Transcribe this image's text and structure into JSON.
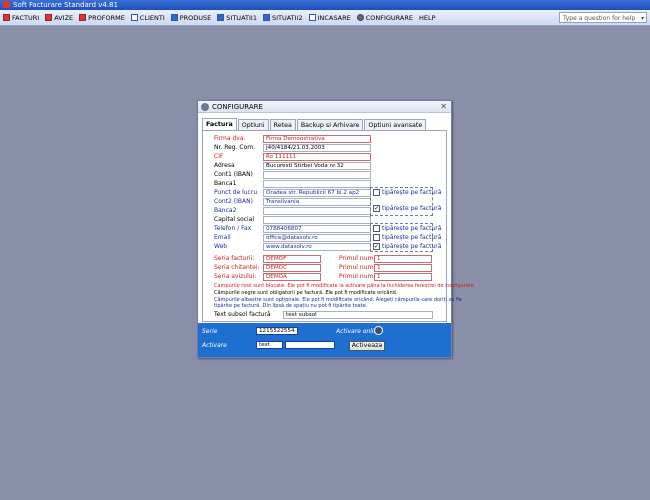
{
  "window": {
    "title": "Soft Facturare Standard v4.81"
  },
  "menu": {
    "items": [
      {
        "label": "FACTURI"
      },
      {
        "label": "AVIZE"
      },
      {
        "label": "PROFORME"
      },
      {
        "label": "CLIENTI"
      },
      {
        "label": "PRODUSE"
      },
      {
        "label": "SITUATII1"
      },
      {
        "label": "SITUATII2"
      },
      {
        "label": "INCASARE"
      },
      {
        "label": "CONFIGURARE"
      },
      {
        "label": "HELP"
      }
    ],
    "help_placeholder": "Type a question for help"
  },
  "dialog": {
    "title": "CONFIGURARE",
    "tabs": [
      "Factura",
      "Optiuni",
      "Retea",
      "Backup si Arhivare",
      "Optiuni avansate"
    ],
    "active_tab": "Factura",
    "fields": {
      "firma_label": "Firma dva.",
      "firma": "Firma Demonstrativa",
      "reg_label": "Nr. Reg. Com.",
      "reg": "J40/4184/21.03.2003",
      "cif_label": "CIF",
      "cif": "Ro 111111",
      "adresa_label": "Adresa",
      "adresa": "Bucuresti Stirbei Voda nr.32",
      "cont1_label": "Cont1 (IBAN)",
      "cont1": "",
      "banca1_label": "Banca1",
      "banca1": "",
      "punct_label": "Punct de lucru",
      "punct": "Oradea str. Republicii 67 bl.2 ap2",
      "cont2_label": "Cont2 (IBAN)",
      "cont2": "Transilvania",
      "banca2_label": "Banca2",
      "banca2": "",
      "capital_label": "Capital social",
      "capital": "",
      "telefon_label": "Telefon / Fax",
      "telefon": "0788406807",
      "email_label": "Email",
      "email": "office@datasolv.ro",
      "web_label": "Web",
      "web": "www.datasolv.ro"
    },
    "print_checks": [
      {
        "label": "tipărește pe factură",
        "checked": false
      },
      {
        "label": "tipărește pe factură",
        "checked": true
      },
      {
        "label": "tipărește pe factură",
        "checked": false
      },
      {
        "label": "tipărește pe factură",
        "checked": false
      },
      {
        "label": "tipărește pe factură",
        "checked": true
      }
    ],
    "series": [
      {
        "label": "Seria facturii:",
        "value": "DEMOF",
        "primul_label": "Primul număr:",
        "primul": "1"
      },
      {
        "label": "Seria chitantei:",
        "value": "DEMOC",
        "primul_label": "Primul număr:",
        "primul": "1"
      },
      {
        "label": "Seria avizului:",
        "value": "DEMOA",
        "primul_label": "Primul număr:",
        "primul": "1"
      }
    ],
    "notes": {
      "red": "Campurile rosii sunt blocate. Ele pot fi modificate la activare pâna la închiderea ferestrei de configurare.",
      "black": "Câmpurile negre sunt obligatorii pe factură. Ele pot fi modificate oricând.",
      "blue1": "Câmpurile albastre sunt opționale. Ele pot fi modificate oricând. Alegeți câmpurile care doriți sa fie",
      "blue2": "tipărite pe factură. Din lipsă de spațiu nu pot fi tipărite toate."
    },
    "subsol_label": "Text subsol factură",
    "subsol": "text subsol",
    "activation": {
      "serie_label": "Serie",
      "serie": "1215522554",
      "online_label": "Activare online",
      "cod_label": "Activare",
      "cod1": "test",
      "cod2": "",
      "button": "Activeaza"
    }
  },
  "colors": {
    "desktop": "#8a8fa8",
    "accent": "#1f6fd0",
    "required": "#d21b1b",
    "optional": "#1a2f99"
  }
}
